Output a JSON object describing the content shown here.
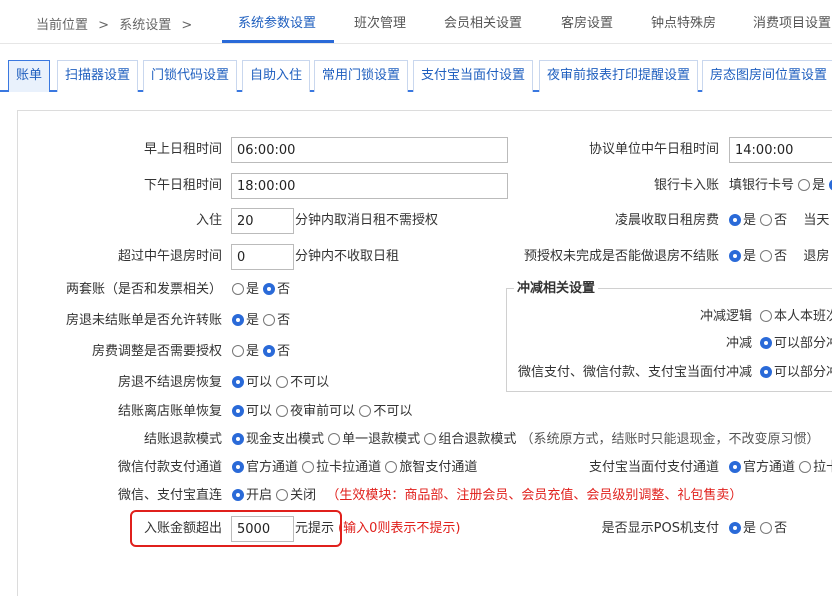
{
  "breadcrumb": {
    "current": "当前位置",
    "sep1": ">",
    "page": "系统设置",
    "sep2": ">"
  },
  "top_tabs": [
    {
      "label": "系统参数设置",
      "active": true
    },
    {
      "label": "班次管理",
      "active": false
    },
    {
      "label": "会员相关设置",
      "active": false
    },
    {
      "label": "客房设置",
      "active": false
    },
    {
      "label": "钟点特殊房",
      "active": false
    },
    {
      "label": "消费项目设置",
      "active": false
    }
  ],
  "sub_tabs": [
    {
      "label": "账单",
      "active": true
    },
    {
      "label": "扫描器设置",
      "active": false
    },
    {
      "label": "门锁代码设置",
      "active": false
    },
    {
      "label": "自助入住",
      "active": false
    },
    {
      "label": "常用门锁设置",
      "active": false
    },
    {
      "label": "支付宝当面付设置",
      "active": false
    },
    {
      "label": "夜审前报表打印提醒设置",
      "active": false
    },
    {
      "label": "房态图房间位置设置",
      "active": false
    }
  ],
  "left": {
    "morning_rent": {
      "label": "早上日租时间",
      "value": "06:00:00"
    },
    "afternoon_rent": {
      "label": "下午日租时间",
      "value": "18:00:00"
    },
    "checkin": {
      "label": "入住",
      "value": "20",
      "suffix": "分钟内取消日租不需授权"
    },
    "over_noon": {
      "label": "超过中午退房时间",
      "value": "0",
      "suffix": "分钟内不收取日租"
    },
    "two_accounts": {
      "label": "两套账（是否和发票相关）",
      "opt_yes": "是",
      "opt_no": "否",
      "selected": "no"
    },
    "checkout_transfer": {
      "label": "房退未结账单是否允许转账",
      "opt_yes": "是",
      "opt_no": "否",
      "selected": "yes"
    },
    "rate_adjust": {
      "label": "房费调整是否需要授权",
      "opt_yes": "是",
      "opt_no": "否",
      "selected": "no"
    },
    "checkout_restore": {
      "label": "房退不结退房恢复",
      "opt_a": "可以",
      "opt_b": "不可以",
      "selected": "a"
    },
    "settle_restore": {
      "label": "结账离店账单恢复",
      "opt_a": "可以",
      "opt_b": "夜审前可以",
      "opt_c": "不可以",
      "selected": "a"
    },
    "refund_mode": {
      "label": "结账退款模式",
      "opt_a": "现金支出模式",
      "opt_b": "单一退款模式",
      "opt_c": "组合退款模式",
      "note": "（系统原方式，结账时只能退现金，不改变原习惯）",
      "selected": "a"
    },
    "wechat_channel": {
      "label": "微信付款支付通道",
      "opt_a": "官方通道",
      "opt_b": "拉卡拉通道",
      "opt_c": "旅智支付通道",
      "selected": "a"
    },
    "direct_connect": {
      "label": "微信、支付宝直连",
      "opt_on": "开启",
      "opt_off": "关闭",
      "note": "（生效模块：商品部、注册会员、会员充值、会员级别调整、礼包售卖）",
      "selected": "on"
    },
    "amount_alert": {
      "label": "入账金额超出",
      "value": "5000",
      "suffix": "元提示",
      "note": "(输入0则表示不提示)"
    }
  },
  "right": {
    "agreement_noon": {
      "label": "协议单位中午日租时间",
      "value": "14:00:00"
    },
    "bank_card": {
      "label": "银行卡入账",
      "text": "填银行卡号",
      "opt_yes": "是"
    },
    "early_rent": {
      "label": "凌晨收取日租房费",
      "opt_yes": "是",
      "opt_no": "否",
      "selected": "yes",
      "extra": "当天"
    },
    "preauth": {
      "label": "预授权未完成是否能做退房不结账",
      "opt_yes": "是",
      "opt_no": "否",
      "selected": "yes",
      "extra": "退房"
    },
    "offset_group": {
      "legend": "冲减相关设置",
      "logic": {
        "label": "冲减逻辑",
        "opt": "本人本班次"
      },
      "offset": {
        "label": "冲减",
        "opt": "可以部分冲"
      },
      "pay_offset": {
        "label": "微信支付、微信付款、支付宝当面付冲减",
        "opt": "可以部分冲"
      }
    },
    "alipay_channel": {
      "label": "支付宝当面付支付通道",
      "opt_a": "官方通道",
      "opt_b": "拉卡",
      "selected": "a"
    },
    "pos_display": {
      "label": "是否显示POS机支付",
      "opt_yes": "是",
      "opt_no": "否",
      "selected": "yes"
    }
  },
  "colors": {
    "accent": "#2a6ad8",
    "alert": "#e0201c"
  }
}
